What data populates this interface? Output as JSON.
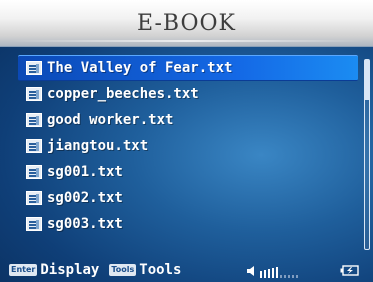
{
  "header": {
    "title": "E-BOOK"
  },
  "files": [
    {
      "name": "The Valley of Fear.txt",
      "selected": true
    },
    {
      "name": "copper_beeches.txt",
      "selected": false
    },
    {
      "name": "good worker.txt",
      "selected": false
    },
    {
      "name": "jiangtou.txt",
      "selected": false
    },
    {
      "name": "sg001.txt",
      "selected": false
    },
    {
      "name": "sg002.txt",
      "selected": false
    },
    {
      "name": "sg003.txt",
      "selected": false
    }
  ],
  "footer": {
    "enter_key": "Enter",
    "enter_action": "Display",
    "tools_key": "Tools",
    "tools_action": "Tools",
    "volume_level": 0.5,
    "icons": [
      "speaker-icon",
      "battery-icon"
    ]
  },
  "colors": {
    "selection": "#1469e6",
    "background": "#1f5f9c",
    "header": "#f2f2f2"
  }
}
